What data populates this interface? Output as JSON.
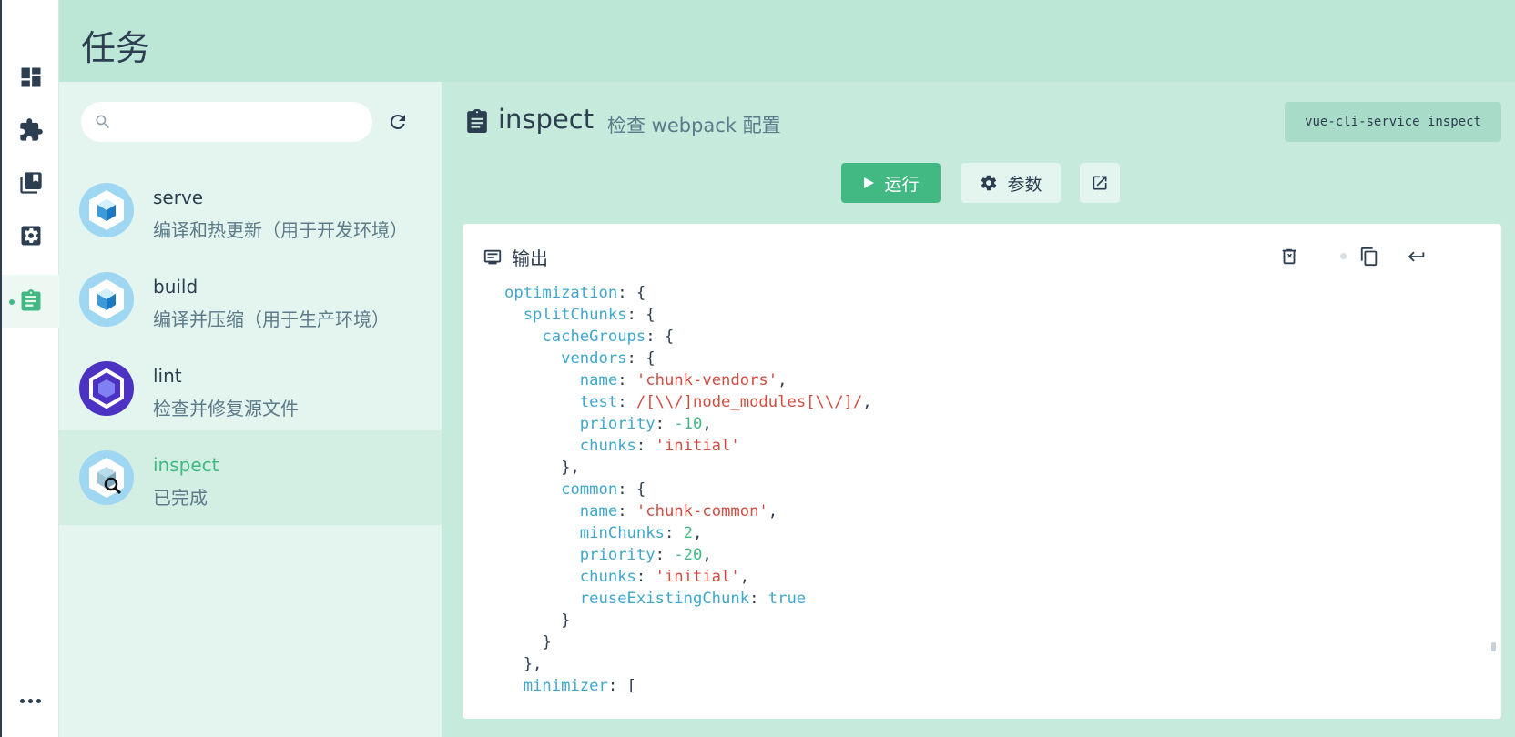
{
  "header": {
    "title": "任务"
  },
  "search": {
    "placeholder": "",
    "value": ""
  },
  "tasks": [
    {
      "name": "serve",
      "description": "编译和热更新（用于开发环境）",
      "icon": "webpack-cube-icon"
    },
    {
      "name": "build",
      "description": "编译并压缩（用于生产环境）",
      "icon": "webpack-cube-icon"
    },
    {
      "name": "lint",
      "description": "检查并修复源文件",
      "icon": "eslint-hexagon-icon"
    },
    {
      "name": "inspect",
      "description": "已完成",
      "icon": "webpack-inspect-icon",
      "selected": true
    }
  ],
  "detail": {
    "name": "inspect",
    "description": "检查 webpack 配置",
    "command": "vue-cli-service inspect",
    "run_label": "运行",
    "params_label": "参数"
  },
  "output": {
    "title": "输出",
    "lines": [
      [
        [
          "k",
          "optimization"
        ],
        [
          "p",
          ": {"
        ]
      ],
      [
        [
          "p",
          "  "
        ],
        [
          "k",
          "splitChunks"
        ],
        [
          "p",
          ": {"
        ]
      ],
      [
        [
          "p",
          "    "
        ],
        [
          "k",
          "cacheGroups"
        ],
        [
          "p",
          ": {"
        ]
      ],
      [
        [
          "p",
          "      "
        ],
        [
          "k",
          "vendors"
        ],
        [
          "p",
          ": {"
        ]
      ],
      [
        [
          "p",
          "        "
        ],
        [
          "k",
          "name"
        ],
        [
          "p",
          ": "
        ],
        [
          "s",
          "'chunk-vendors'"
        ],
        [
          "p",
          ","
        ]
      ],
      [
        [
          "p",
          "        "
        ],
        [
          "k",
          "test"
        ],
        [
          "p",
          ": "
        ],
        [
          "s",
          "/[\\\\/]node_modules[\\\\/]/"
        ],
        [
          "p",
          ","
        ]
      ],
      [
        [
          "p",
          "        "
        ],
        [
          "k",
          "priority"
        ],
        [
          "p",
          ": "
        ],
        [
          "n",
          "-10"
        ],
        [
          "p",
          ","
        ]
      ],
      [
        [
          "p",
          "        "
        ],
        [
          "k",
          "chunks"
        ],
        [
          "p",
          ": "
        ],
        [
          "s",
          "'initial'"
        ]
      ],
      [
        [
          "p",
          "      },"
        ]
      ],
      [
        [
          "p",
          "      "
        ],
        [
          "k",
          "common"
        ],
        [
          "p",
          ": {"
        ]
      ],
      [
        [
          "p",
          "        "
        ],
        [
          "k",
          "name"
        ],
        [
          "p",
          ": "
        ],
        [
          "s",
          "'chunk-common'"
        ],
        [
          "p",
          ","
        ]
      ],
      [
        [
          "p",
          "        "
        ],
        [
          "k",
          "minChunks"
        ],
        [
          "p",
          ": "
        ],
        [
          "n",
          "2"
        ],
        [
          "p",
          ","
        ]
      ],
      [
        [
          "p",
          "        "
        ],
        [
          "k",
          "priority"
        ],
        [
          "p",
          ": "
        ],
        [
          "n",
          "-20"
        ],
        [
          "p",
          ","
        ]
      ],
      [
        [
          "p",
          "        "
        ],
        [
          "k",
          "chunks"
        ],
        [
          "p",
          ": "
        ],
        [
          "s",
          "'initial'"
        ],
        [
          "p",
          ","
        ]
      ],
      [
        [
          "p",
          "        "
        ],
        [
          "k",
          "reuseExistingChunk"
        ],
        [
          "p",
          ": "
        ],
        [
          "b",
          "true"
        ]
      ],
      [
        [
          "p",
          "      }"
        ]
      ],
      [
        [
          "p",
          "    }"
        ]
      ],
      [
        [
          "p",
          "  },"
        ]
      ],
      [
        [
          "p",
          "  "
        ],
        [
          "k",
          "minimizer"
        ],
        [
          "p",
          ": ["
        ]
      ]
    ]
  },
  "colors": {
    "accent": "#42b983",
    "header_bg": "#bce7d6",
    "panel_bg": "#e3f5ee",
    "key": "#3fa7cc",
    "string": "#d14d41"
  }
}
